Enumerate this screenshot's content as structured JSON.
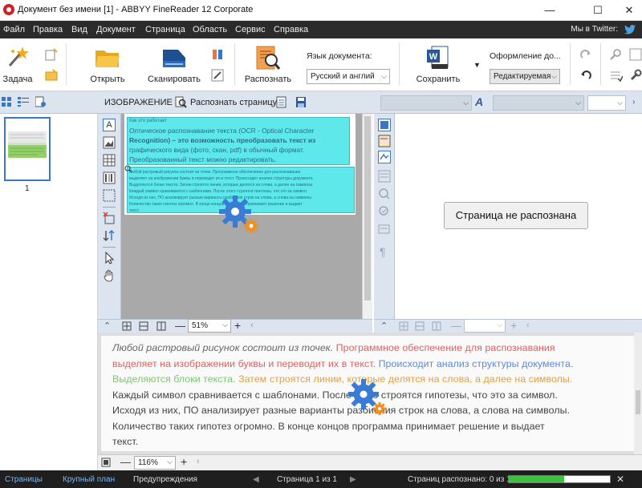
{
  "window": {
    "title": "Документ без имени [1] - ABBYY FineReader 12 Corporate",
    "controls": {
      "minimize": "—",
      "maximize": "☐",
      "close": "✕"
    }
  },
  "menu": {
    "items": [
      "Файл",
      "Правка",
      "Вид",
      "Документ",
      "Страница",
      "Область",
      "Сервис",
      "Справка"
    ],
    "twitter_label": "Мы в Twitter:"
  },
  "toolbar": {
    "task_label": "Задача",
    "open_label": "Открыть",
    "scan_label": "Сканировать",
    "recognize_label": "Распознать",
    "doc_language_label": "Язык документа:",
    "doc_language_value": "Русский и англий",
    "save_label": "Сохранить",
    "layout_label": "Оформление до...",
    "layout_value": "Редактируемая"
  },
  "image_pane": {
    "header": "ИЗОБРАЖЕНИЕ",
    "recognize_page_label": "Распознать страницу",
    "zoom_value": "51%",
    "content_lines": [
      "Как это работает",
      "Оптическое распознавание текста (OCR - Optical Character",
      "Recognition) – это возможность преобразовать текст из",
      "графического вида (фото, скан, pdf) в обычный формат.",
      "Преобразованный текст можно редактировать."
    ],
    "block_lines": [
      "Любой растровый рисунок состоит из точек. Программное обеспечение для распознавания",
      "выделяет на изображении буквы и переводит их в текст. Происходит анализ структуры документа.",
      "Выделяются блоки текста. Затем строятся линии, которые делятся на слова, а далее на символы.",
      "Каждый символ сравнивается с шаблонами. После этого строятся гипотезы, что это за символ.",
      "Исходя из них, ПО анализирует разные варианты разбиения строк на слова, а слова на символы.",
      "Количество таких гипотез огромно. В конце концов программа принимает решение и выдает",
      "текст."
    ]
  },
  "text_pane": {
    "not_recognized": "Страница не распознана",
    "pilcrow": "¶"
  },
  "zoom_pane": {
    "lines": [
      [
        {
          "t": "Любой растровый рисунок состоит из точек. ",
          "c": "#666666",
          "i": true
        },
        {
          "t": "Программное обеспечение для распознавания",
          "c": "#e06060",
          "i": false
        }
      ],
      [
        {
          "t": "выделяет на изображении буквы и переводит их в текст. ",
          "c": "#e06060",
          "i": false
        },
        {
          "t": "Происходит анализ структуры документа.",
          "c": "#5b8bd9",
          "i": false
        }
      ],
      [
        {
          "t": "Выделяются блоки текста. ",
          "c": "#7cc46e",
          "i": false
        },
        {
          "t": "Затем строятся линии, которые делятся на слова, а далее на символы.",
          "c": "#e0a040",
          "i": false
        }
      ],
      [
        {
          "t": "Каждый символ сравнивается с шаблонами. После этого строятся гипотезы, что это за символ.",
          "c": "#444444",
          "i": false
        }
      ],
      [
        {
          "t": "Исходя из них, ПО анализирует разные варианты разбиения строк на слова, а слова на символы.",
          "c": "#444444",
          "i": false
        }
      ],
      [
        {
          "t": "Количество таких гипотез огромно. В конце концов программа принимает решение и выдает",
          "c": "#444444",
          "i": false
        }
      ],
      [
        {
          "t": "текст.",
          "c": "#444444",
          "i": false
        }
      ]
    ],
    "zoom_value": "116%"
  },
  "pages_panel": {
    "page_number": "1"
  },
  "statusbar": {
    "tabs": [
      "Страницы",
      "Крупный план",
      "Предупреждения"
    ],
    "page_info": "Страница 1 из 1",
    "recognized_info": "Страниц распознано: 0 из 1",
    "progress": 0.55
  },
  "colors": {
    "menubar": "#2b2b2b",
    "panel_blue": "#dbe4ef",
    "selection": "#5fe8ea",
    "gear": "#3a7bd5",
    "gear_small": "#f09020",
    "progress": "#3ec13e"
  }
}
